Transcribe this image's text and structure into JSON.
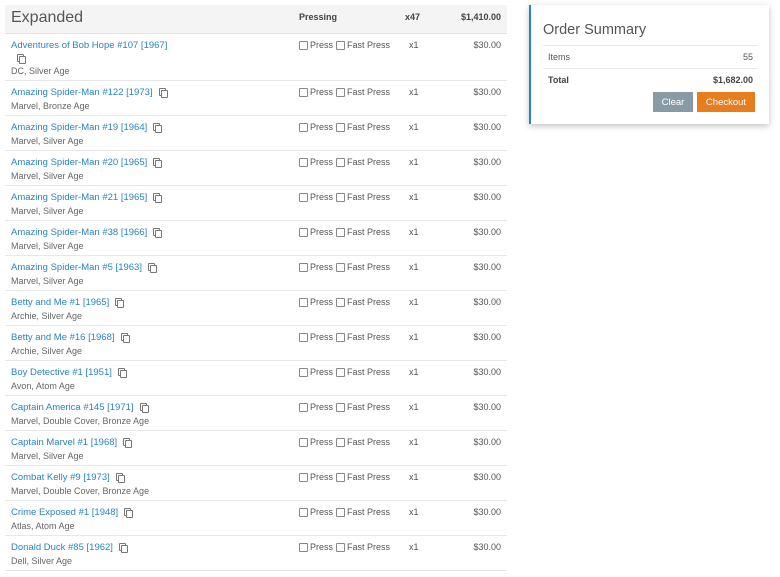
{
  "cart": {
    "title": "Expanded",
    "col_pressing": "Pressing",
    "col_qty": "x47",
    "col_total": "$1,410.00",
    "press_label": "Press",
    "fast_press_label": "Fast Press",
    "items": [
      {
        "title": "Adventures of Bob Hope #107 [1967]",
        "sub": "DC, Silver Age",
        "qty": "x1",
        "price": "$30.00"
      },
      {
        "title": "Amazing Spider-Man #122 [1973]",
        "sub": "Marvel, Bronze Age",
        "qty": "x1",
        "price": "$30.00"
      },
      {
        "title": "Amazing Spider-Man #19 [1964]",
        "sub": "Marvel, Silver Age",
        "qty": "x1",
        "price": "$30.00"
      },
      {
        "title": "Amazing Spider-Man #20 [1965]",
        "sub": "Marvel, Silver Age",
        "qty": "x1",
        "price": "$30.00"
      },
      {
        "title": "Amazing Spider-Man #21 [1965]",
        "sub": "Marvel, Silver Age",
        "qty": "x1",
        "price": "$30.00"
      },
      {
        "title": "Amazing Spider-Man #38 [1966]",
        "sub": "Marvel, Silver Age",
        "qty": "x1",
        "price": "$30.00"
      },
      {
        "title": "Amazing Spider-Man #5 [1963]",
        "sub": "Marvel, Silver Age",
        "qty": "x1",
        "price": "$30.00"
      },
      {
        "title": "Betty and Me #1 [1965]",
        "sub": "Archie, Silver Age",
        "qty": "x1",
        "price": "$30.00"
      },
      {
        "title": "Betty and Me #16 [1968]",
        "sub": "Archie, Silver Age",
        "qty": "x1",
        "price": "$30.00"
      },
      {
        "title": "Boy Detective #1 [1951]",
        "sub": "Avon, Atom Age",
        "qty": "x1",
        "price": "$30.00"
      },
      {
        "title": "Captain America #145 [1971]",
        "sub": "Marvel, Double Cover, Bronze Age",
        "qty": "x1",
        "price": "$30.00"
      },
      {
        "title": "Captain Marvel #1 [1968]",
        "sub": "Marvel, Silver Age",
        "qty": "x1",
        "price": "$30.00"
      },
      {
        "title": "Combat Kelly #9 [1973]",
        "sub": "Marvel, Double Cover, Bronze Age",
        "qty": "x1",
        "price": "$30.00"
      },
      {
        "title": "Crime Exposed #1 [1948]",
        "sub": "Atlas, Atom Age",
        "qty": "x1",
        "price": "$30.00"
      },
      {
        "title": "Donald Duck #85 [1962]",
        "sub": "Dell, Silver Age",
        "qty": "x1",
        "price": "$30.00"
      }
    ]
  },
  "summary": {
    "title": "Order Summary",
    "items_label": "Items",
    "items_value": "55",
    "total_label": "Total",
    "total_value": "$1,682.00",
    "clear_label": "Clear",
    "checkout_label": "Checkout"
  },
  "colors": {
    "link": "#2a83c4",
    "accent_border": "#2a83c4",
    "clear_button": "#8a9aa4",
    "checkout_button": "#e87d1e"
  },
  "icons": {
    "copy": "copy-icon"
  }
}
